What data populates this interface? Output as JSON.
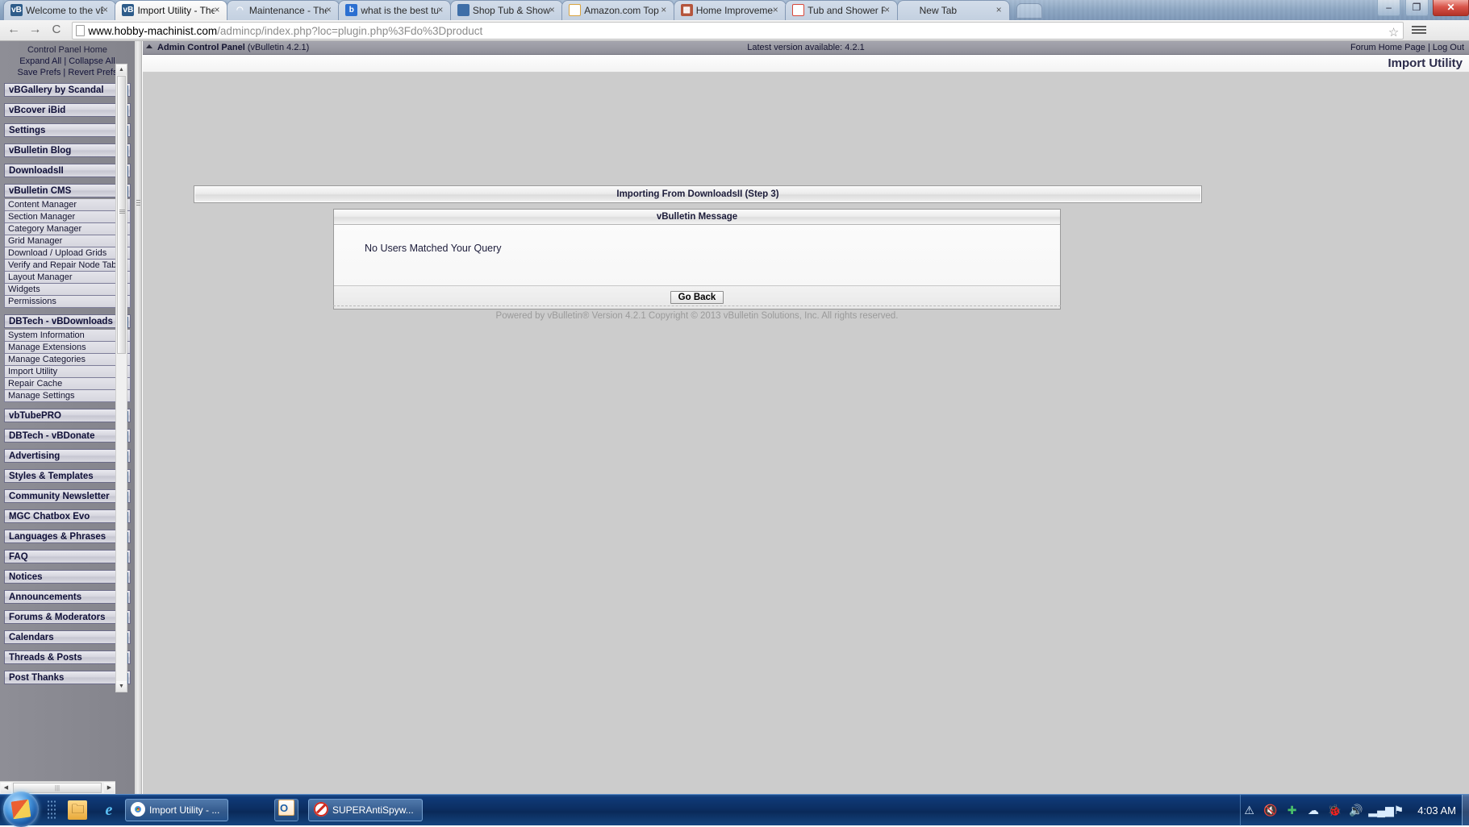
{
  "browser": {
    "tabs": [
      {
        "title": "Welcome to the vBul",
        "favicon": "vbulletin-icon",
        "active": false
      },
      {
        "title": "Import Utility - The H",
        "favicon": "vbulletin-icon",
        "active": true
      },
      {
        "title": "Maintenance - The H",
        "favicon": "loading-spinner-icon",
        "active": false
      },
      {
        "title": "what is the best tub a",
        "favicon": "bing-icon",
        "active": false
      },
      {
        "title": "Shop Tub & Shower",
        "favicon": "shopping-icon",
        "active": false
      },
      {
        "title": "Amazon.com Top Ra",
        "favicon": "amazon-icon",
        "active": false
      },
      {
        "title": "Home Improvement",
        "favicon": "home-improvement-icon",
        "active": false
      },
      {
        "title": "Tub and Shower Fauc",
        "favicon": "tub-icon",
        "active": false
      },
      {
        "title": "New Tab",
        "favicon": "blank-icon",
        "active": false
      }
    ],
    "close_glyph": "×",
    "window_controls": {
      "minimize": "–",
      "restore": "❐",
      "close": "✕"
    },
    "nav": {
      "back": "←",
      "forward": "→",
      "reload": "C"
    },
    "url_host": "www.hobby-machinist.com",
    "url_path": "/admincp/index.php?loc=plugin.php%3Fdo%3Dproduct",
    "star_glyph": "☆"
  },
  "sidebar": {
    "links": {
      "home": "Control Panel Home",
      "expand_all": "Expand All",
      "collapse_all": "Collapse All",
      "save_prefs": "Save Prefs",
      "revert_prefs": "Revert Prefs",
      "separator": "|"
    },
    "arrow_collapsed": "▶",
    "arrow_expanded": "▲",
    "groups": [
      {
        "label": "vBGallery by Scandal",
        "expanded": false,
        "items": []
      },
      {
        "label": "vBcover iBid",
        "expanded": false,
        "items": []
      },
      {
        "label": "Settings",
        "expanded": false,
        "items": []
      },
      {
        "label": "vBulletin Blog",
        "expanded": false,
        "items": []
      },
      {
        "label": "DownloadsII",
        "expanded": false,
        "items": []
      },
      {
        "label": "vBulletin CMS",
        "expanded": true,
        "items": [
          "Content Manager",
          "Section Manager",
          "Category Manager",
          "Grid Manager",
          "Download / Upload Grids",
          "Verify and Repair Node Table",
          "Layout Manager",
          "Widgets",
          "Permissions"
        ]
      },
      {
        "label": "DBTech - vBDownloads",
        "expanded": true,
        "items": [
          "System Information",
          "Manage Extensions",
          "Manage Categories",
          "Import Utility",
          "Repair Cache",
          "Manage Settings"
        ]
      },
      {
        "label": "vbTubePRO",
        "expanded": false,
        "items": []
      },
      {
        "label": "DBTech - vBDonate",
        "expanded": false,
        "items": []
      },
      {
        "label": "Advertising",
        "expanded": false,
        "items": []
      },
      {
        "label": "Styles & Templates",
        "expanded": false,
        "items": []
      },
      {
        "label": "Community Newsletter",
        "expanded": false,
        "items": []
      },
      {
        "label": "MGC Chatbox Evo",
        "expanded": false,
        "items": []
      },
      {
        "label": "Languages & Phrases",
        "expanded": false,
        "items": []
      },
      {
        "label": "FAQ",
        "expanded": false,
        "items": []
      },
      {
        "label": "Notices",
        "expanded": false,
        "items": []
      },
      {
        "label": "Announcements",
        "expanded": false,
        "items": []
      },
      {
        "label": "Forums & Moderators",
        "expanded": false,
        "items": []
      },
      {
        "label": "Calendars",
        "expanded": false,
        "items": []
      },
      {
        "label": "Threads & Posts",
        "expanded": false,
        "items": []
      },
      {
        "label": "Post Thanks",
        "expanded": false,
        "items": []
      }
    ]
  },
  "acp": {
    "panel_name": "Admin Control Panel",
    "panel_version": "(vBulletin 4.2.1)",
    "latest_version": "Latest version available: 4.2.1",
    "forum_home_link": "Forum Home Page",
    "link_separator": "|",
    "logout_link": "Log Out",
    "page_title": "Import Utility"
  },
  "content": {
    "step_bar_title": "Importing From DownloadsII (Step 3)",
    "message_box_title": "vBulletin Message",
    "message_body": "No Users Matched Your Query",
    "go_back_button": "Go Back",
    "copyright": "Powered by vBulletin® Version 4.2.1 Copyright © 2013 vBulletin Solutions, Inc. All rights reserved."
  },
  "taskbar": {
    "quick_launch": [
      "show-desktop-icon",
      "windows-explorer-icon",
      "internet-explorer-icon"
    ],
    "items": [
      {
        "label": "Import Utility - ...",
        "icon": "chrome-icon"
      },
      {
        "label": "",
        "icon": "outlook-icon"
      },
      {
        "label": "SUPERAntiSpyw...",
        "icon": "superantispyware-icon"
      }
    ],
    "tray_icons": [
      "action-center-warning-icon",
      "volume-muted-icon",
      "antivirus-icon",
      "cloud-icon",
      "malwarebytes-icon",
      "speaker-icon",
      "signal-bars-icon",
      "network-error-icon"
    ],
    "clock": "4:03 AM"
  }
}
